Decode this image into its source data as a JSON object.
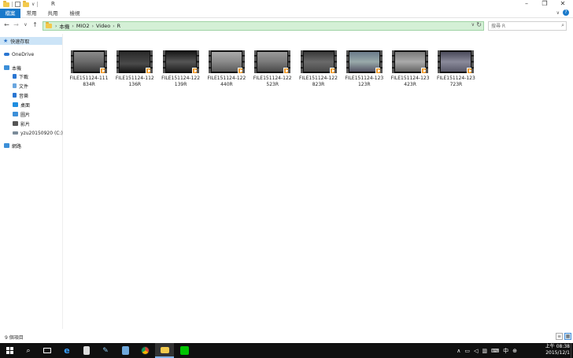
{
  "title_bar": {
    "title": "R",
    "minimize": "–",
    "maximize": "❐",
    "close": "✕",
    "dropdown": "∨"
  },
  "ribbon": {
    "tabs": [
      "檔案",
      "常用",
      "共用",
      "檢視"
    ],
    "help": "?"
  },
  "address": {
    "back": "←",
    "forward": "→",
    "recent": "∨",
    "up": "↑",
    "crumbs": [
      "本機",
      "MIO2",
      "Video",
      "R"
    ],
    "dropdown": "∨",
    "refresh": "↻"
  },
  "search": {
    "placeholder": "搜尋 R"
  },
  "nav": {
    "quick_access": "快速存取",
    "onedrive": "OneDrive",
    "this_pc": "本機",
    "downloads": "下載",
    "documents": "文件",
    "music": "音樂",
    "desktop": "桌面",
    "pictures": "圖片",
    "videos": "影片",
    "drive_c": "yzu20150920 (C:)",
    "network": "網路"
  },
  "files": [
    {
      "line1": "FILE151124-111",
      "line2": "834R"
    },
    {
      "line1": "FILE151124-112",
      "line2": "136R"
    },
    {
      "line1": "FILE151124-122",
      "line2": "139R"
    },
    {
      "line1": "FILE151124-122",
      "line2": "440R"
    },
    {
      "line1": "FILE151124-122",
      "line2": "523R"
    },
    {
      "line1": "FILE151124-122",
      "line2": "823R"
    },
    {
      "line1": "FILE151124-123",
      "line2": "123R"
    },
    {
      "line1": "FILE151124-123",
      "line2": "423R"
    },
    {
      "line1": "FILE151124-123",
      "line2": "723R"
    }
  ],
  "status": {
    "item_count": "9 個項目"
  },
  "taskbar": {
    "clock_time": "上午 08:38",
    "clock_date": "2015/12/1",
    "ime": "中"
  },
  "colors": {
    "accent": "#1979ca",
    "address_bar_bg": "#d4f0d6",
    "video_badge": "#f29b2c"
  }
}
